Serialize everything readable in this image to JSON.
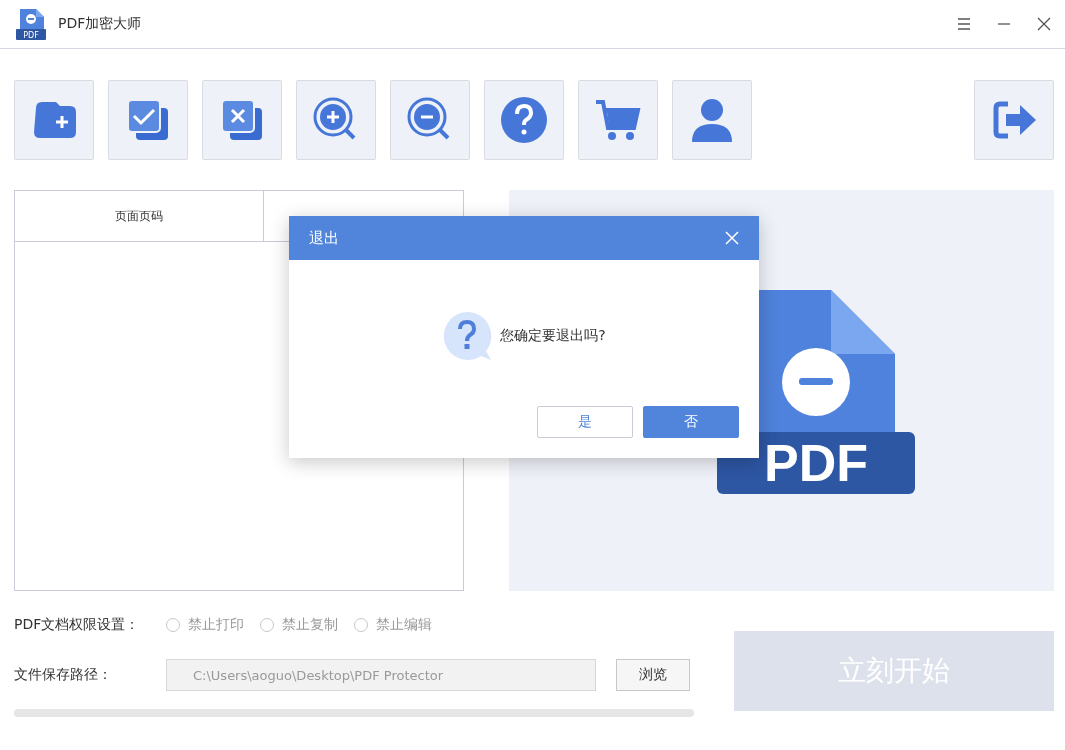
{
  "window": {
    "title": "PDF加密大师",
    "logo_text": "PDF"
  },
  "toolbar": [
    {
      "kind": "add-folder"
    },
    {
      "kind": "check-all"
    },
    {
      "kind": "remove"
    },
    {
      "kind": "zoom-in"
    },
    {
      "kind": "zoom-out"
    },
    {
      "kind": "help"
    },
    {
      "kind": "cart"
    },
    {
      "kind": "user"
    }
  ],
  "exit_button": {
    "kind": "exit"
  },
  "table": {
    "columns": [
      "页面页码"
    ]
  },
  "preview": {
    "badge": "PDF"
  },
  "permissions": {
    "label": "PDF文档权限设置：",
    "options": [
      {
        "label": "禁止打印",
        "checked": false
      },
      {
        "label": "禁止复制",
        "checked": false
      },
      {
        "label": "禁止编辑",
        "checked": false
      }
    ]
  },
  "save_path": {
    "label": "文件保存路径：",
    "value": "C:\\Users\\aoguo\\Desktop\\PDF Protector",
    "browse": "浏览"
  },
  "progress": {
    "level": 0
  },
  "start_button": {
    "label": "立刻开始",
    "disabled": true
  },
  "dialog": {
    "title": "退出",
    "message": "您确定要退出吗?",
    "buttons": [
      {
        "label": "是",
        "primary": false
      },
      {
        "label": "否",
        "primary": true
      }
    ]
  }
}
